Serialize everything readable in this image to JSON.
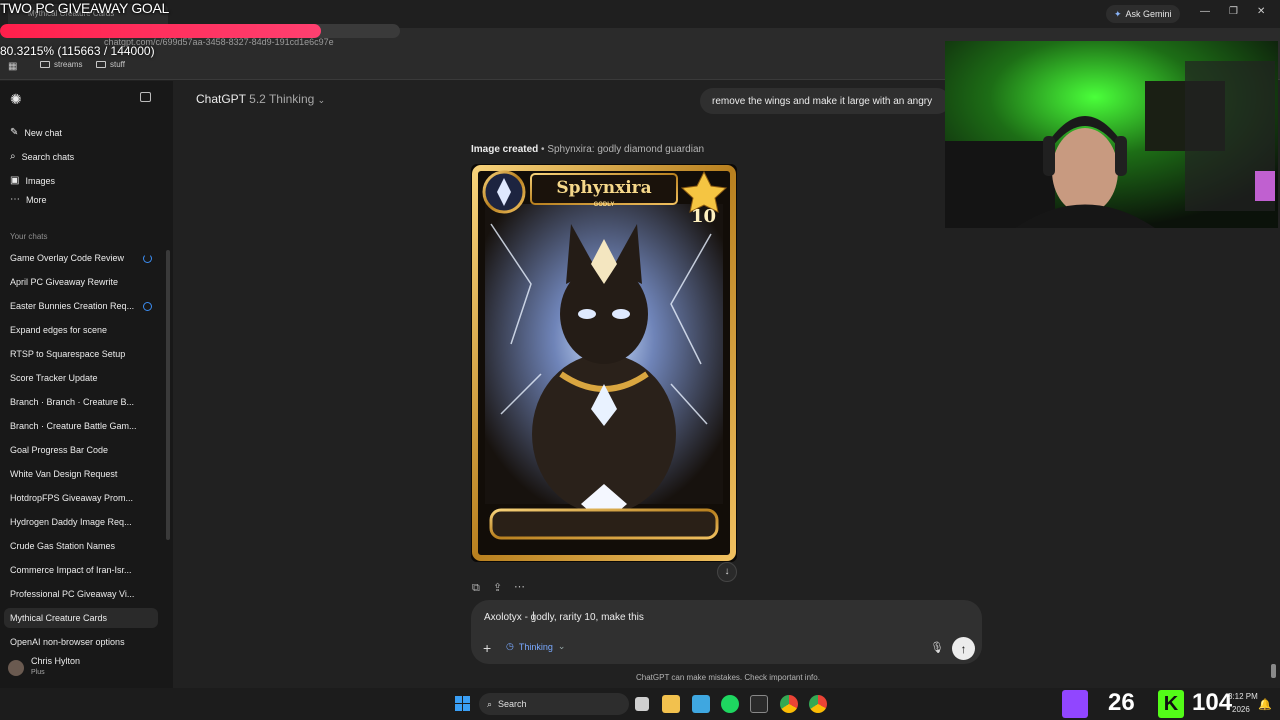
{
  "overlay": {
    "goal_title": "TWO PC GIVEAWAY GOAL",
    "goal_progress_text": "80.3215% (115663 / 144000)",
    "goal_fraction": 0.803215
  },
  "browser": {
    "tab_title": "Mythical Creature Cards",
    "url": "chatgpt.com/c/699d57aa-3458-8327-84d9-191cd1e6c97e",
    "ask_gemini": "Ask Gemini",
    "bookmarks": [
      "streams",
      "stuff"
    ]
  },
  "sidebar": {
    "nav": [
      {
        "icon": "compose-icon",
        "label": "New chat"
      },
      {
        "icon": "search-icon",
        "label": "Search chats"
      },
      {
        "icon": "images-icon",
        "label": "Images"
      },
      {
        "icon": "more-icon",
        "label": "More"
      }
    ],
    "section_label": "Your chats",
    "chats": [
      "Game Overlay Code Review",
      "April PC Giveaway Rewrite",
      "Easter Bunnies Creation Req...",
      "Expand edges for scene",
      "RTSP to Squarespace Setup",
      "Score Tracker Update",
      "Branch · Branch · Creature B...",
      "Branch · Creature Battle Gam...",
      "Goal Progress Bar Code",
      "White Van Design Request",
      "HotdropFPS Giveaway Prom...",
      "Hydrogen Daddy Image Req...",
      "Crude Gas Station Names",
      "Commerce Impact of Iran-Isr...",
      "Professional PC Giveaway Vi...",
      "Mythical Creature Cards",
      "OpenAI non-browser options"
    ],
    "user": {
      "name": "Chris Hylton",
      "plan": "Plus"
    }
  },
  "main": {
    "model": "ChatGPT",
    "model_version": "5.2 Thinking",
    "user_message": "remove the wings and make it large with an angry",
    "image_caption_bold": "Image created",
    "image_caption_rest": " • Sphynxira: godly diamond guardian",
    "card": {
      "name": "Sphynxira",
      "rarity": "GODLY",
      "level": "10"
    },
    "input_text": "Axolotyx - godly, rarity 10, make this",
    "mode_label": "Thinking",
    "disclaimer": "ChatGPT can make mistakes. Check important info."
  },
  "taskbar": {
    "search": "Search",
    "counter_twitch": "26",
    "counter_kick": "104",
    "time": "3:12 PM",
    "date": "2026"
  }
}
